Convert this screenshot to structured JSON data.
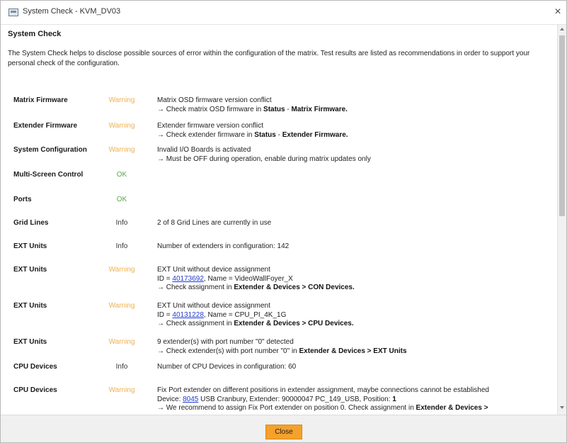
{
  "window": {
    "title": "System Check - KVM_DV03",
    "close_glyph": "×"
  },
  "heading": "System Check",
  "intro": "The System Check helps to disclose possible sources of error within the configuration of the matrix. Test results are listed as recommendations in order to support your personal check of the configuration.",
  "colors": {
    "warning": "#f0b04a",
    "ok": "#58a94a",
    "link": "#1f3ccf",
    "button": "#f5a12b"
  },
  "rows": [
    {
      "category": "Matrix Firmware",
      "status": "Warning",
      "status_type": "warning",
      "lines": [
        [
          {
            "t": "Matrix OSD firmware version conflict"
          }
        ],
        [
          {
            "t": "→ Check matrix OSD firmware in "
          },
          {
            "t": "Status",
            "b": true
          },
          {
            "t": " - "
          },
          {
            "t": "Matrix Firmware.",
            "b": true
          }
        ]
      ]
    },
    {
      "category": "Extender Firmware",
      "status": "Warning",
      "status_type": "warning",
      "lines": [
        [
          {
            "t": "Extender firmware version conflict"
          }
        ],
        [
          {
            "t": "→ Check extender firmware in "
          },
          {
            "t": "Status",
            "b": true
          },
          {
            "t": " - "
          },
          {
            "t": "Extender Firmware.",
            "b": true
          }
        ]
      ]
    },
    {
      "category": "System Configuration",
      "status": "Warning",
      "status_type": "warning",
      "lines": [
        [
          {
            "t": "Invalid I/O Boards is activated"
          }
        ],
        [
          {
            "t": "→ Must be OFF during operation, enable during matrix updates only"
          }
        ]
      ]
    },
    {
      "category": "Multi-Screen Control",
      "status": "OK",
      "status_type": "ok",
      "lines": []
    },
    {
      "category": "Ports",
      "status": "OK",
      "status_type": "ok",
      "lines": []
    },
    {
      "category": "Grid Lines",
      "status": "Info",
      "status_type": "info",
      "lines": [
        [
          {
            "t": "2 of 8 Grid Lines are currently in use"
          }
        ]
      ]
    },
    {
      "category": "EXT Units",
      "status": "Info",
      "status_type": "info",
      "lines": [
        [
          {
            "t": "Number of extenders in configuration: 142"
          }
        ]
      ]
    },
    {
      "category": "EXT Units",
      "status": "Warning",
      "status_type": "warning",
      "lines": [
        [
          {
            "t": "EXT Unit without device assignment"
          }
        ],
        [
          {
            "t": "ID = "
          },
          {
            "t": "40173692",
            "link": true
          },
          {
            "t": ", Name = VideoWallFoyer_X"
          }
        ],
        [
          {
            "t": "→ Check assignment in "
          },
          {
            "t": "Extender & Devices > CON Devices.",
            "b": true
          }
        ]
      ]
    },
    {
      "category": "EXT Units",
      "status": "Warning",
      "status_type": "warning",
      "lines": [
        [
          {
            "t": "EXT Unit without device assignment"
          }
        ],
        [
          {
            "t": "ID = "
          },
          {
            "t": "40131228",
            "link": true
          },
          {
            "t": ", Name = CPU_PI_4K_1G"
          }
        ],
        [
          {
            "t": "→ Check assignment in "
          },
          {
            "t": "Extender & Devices > CPU Devices.",
            "b": true
          }
        ]
      ]
    },
    {
      "category": "EXT Units",
      "status": "Warning",
      "status_type": "warning",
      "lines": [
        [
          {
            "t": "9 extender(s) with port number \"0\" detected"
          }
        ],
        [
          {
            "t": "→ Check extender(s) with port number \"0\" in "
          },
          {
            "t": "Extender & Devices > EXT Units",
            "b": true
          }
        ]
      ]
    },
    {
      "category": "CPU Devices",
      "status": "Info",
      "status_type": "info",
      "lines": [
        [
          {
            "t": "Number of CPU Devices in configuration: 60"
          }
        ]
      ]
    },
    {
      "category": "CPU Devices",
      "status": "Warning",
      "status_type": "warning",
      "lines": [
        [
          {
            "t": "Fix Port extender on different positions in extender assignment, maybe connections cannot be established"
          }
        ],
        [
          {
            "t": "Device: "
          },
          {
            "t": "8045",
            "link": true
          },
          {
            "t": " USB Cranbury, Extender: 90000047 PC_149_USB, Position: "
          },
          {
            "t": "1",
            "b": true
          }
        ],
        [
          {
            "t": "→ We recommend to assign Fix Port extender on position 0. Check assignment in "
          },
          {
            "t": "Extender & Devices >",
            "b": true
          }
        ]
      ]
    }
  ],
  "footer": {
    "close_label": "Close"
  }
}
